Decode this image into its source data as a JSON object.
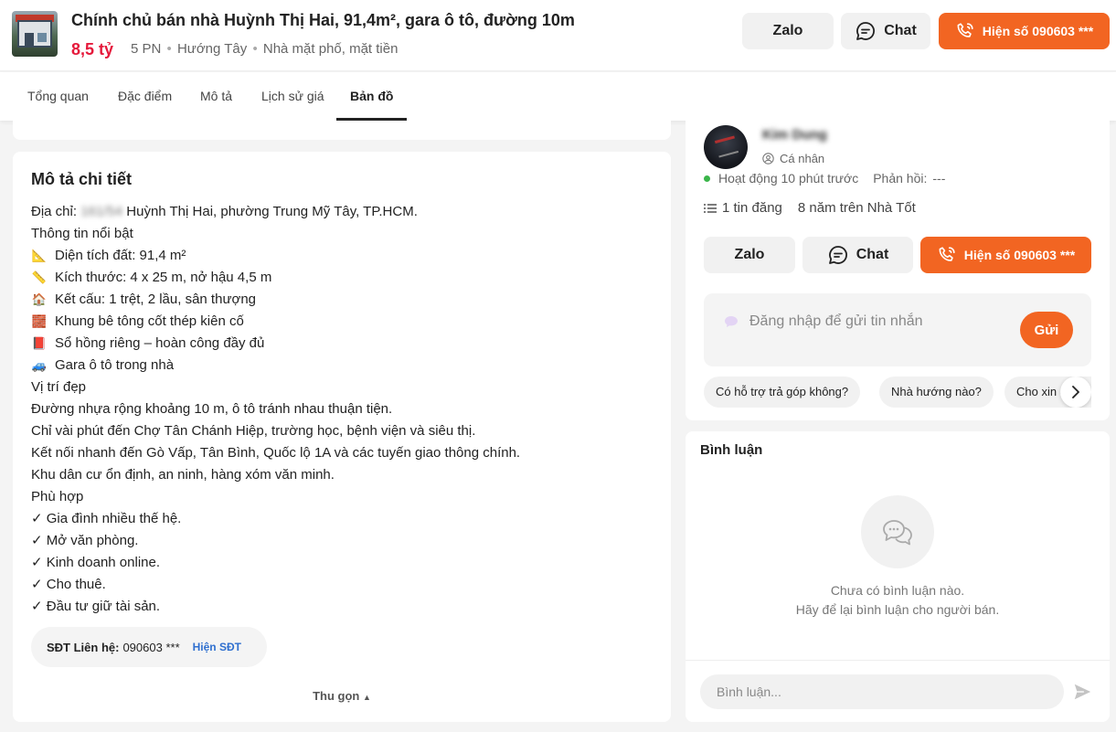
{
  "header": {
    "title": "Chính chủ bán nhà Huỳnh Thị Hai, 91,4m², gara ô tô, đường 10m",
    "price": "8,5 tỷ",
    "bedrooms": "5 PN",
    "direction": "Hướng Tây",
    "type": "Nhà mặt phố, mặt tiền",
    "zalo_label": "Zalo",
    "chat_label": "Chat",
    "phone_label": "Hiện số 090603 ***"
  },
  "tabs": [
    {
      "label": "Tổng quan"
    },
    {
      "label": "Đặc điểm"
    },
    {
      "label": "Mô tả"
    },
    {
      "label": "Lịch sử giá"
    },
    {
      "label": "Bản đồ",
      "active": true
    }
  ],
  "description": {
    "title": "Mô tả chi tiết",
    "address_prefix": "Địa chỉ:",
    "address_hidden": "161/54",
    "address_rest": "Huỳnh Thị Hai, phường Trung Mỹ Tây, TP.HCM.",
    "lines": [
      {
        "icon": "📐",
        "text": "Thông tin nổi bật",
        "no_icon": true
      },
      {
        "icon": "📐",
        "text": "Diện tích đất: 91,4 m²"
      },
      {
        "icon": "📏",
        "text": "Kích thước: 4 x 25 m, nở hậu 4,5 m"
      },
      {
        "icon": "🏠",
        "text": "Kết cấu: 1 trệt, 2 lầu, sân thượng"
      },
      {
        "icon": "🧱",
        "text": "Khung bê tông cốt thép kiên cố"
      },
      {
        "icon": "📕",
        "text": "Sổ hồng riêng – hoàn công đầy đủ"
      },
      {
        "icon": "🚙",
        "text": "Gara ô tô trong nhà"
      },
      {
        "text": "Vị trí đẹp",
        "no_icon": true
      },
      {
        "text": "Đường nhựa rộng khoảng 10 m, ô tô tránh nhau thuận tiện.",
        "no_icon": true
      },
      {
        "text": "Chỉ vài phút đến Chợ Tân Chánh Hiệp, trường học, bệnh viện và siêu thị.",
        "no_icon": true
      },
      {
        "text": "Kết nối nhanh đến Gò Vấp, Tân Bình, Quốc lộ 1A và các tuyến giao thông chính.",
        "no_icon": true
      },
      {
        "text": "Khu dân cư ổn định, an ninh, hàng xóm văn minh.",
        "no_icon": true
      },
      {
        "text": "Phù hợp",
        "no_icon": true
      },
      {
        "text": "✓ Gia đình nhiều thế hệ.",
        "no_icon": true
      },
      {
        "text": "✓ Mở văn phòng.",
        "no_icon": true
      },
      {
        "text": "✓ Kinh doanh online.",
        "no_icon": true
      },
      {
        "text": "✓ Cho thuê.",
        "no_icon": true
      },
      {
        "text": "✓ Đầu tư giữ tài sản.",
        "no_icon": true
      }
    ],
    "phone_label": "SĐT Liên hệ:",
    "phone_value": "090603 ***",
    "phone_show": "Hiện SĐT",
    "collapse_label": "Thu gọn"
  },
  "seller": {
    "name": "Kim Dung",
    "type": "Cá nhân",
    "active": "Hoạt động 10 phút trước",
    "reply_label": "Phản hồi:",
    "reply_value": "---",
    "listings": "1 tin đăng",
    "years": "8 năm trên Nhà Tốt",
    "zalo_label": "Zalo",
    "chat_label": "Chat",
    "phone_label": "Hiện số 090603 ***",
    "message_placeholder": "Đăng nhập để gửi tin nhắn",
    "send_label": "Gửi",
    "quick_replies": [
      "Có hỗ trợ trả góp không?",
      "Nhà hướng nào?",
      "Cho xin địa chỉ cụ thể"
    ]
  },
  "comments": {
    "title": "Bình luận",
    "empty_line1": "Chưa có bình luận nào.",
    "empty_line2": "Hãy để lại bình luận cho người bán.",
    "input_placeholder": "Bình luận..."
  },
  "colors": {
    "accent": "#f26522",
    "price": "#e5193b",
    "link": "#2f6fcf"
  }
}
